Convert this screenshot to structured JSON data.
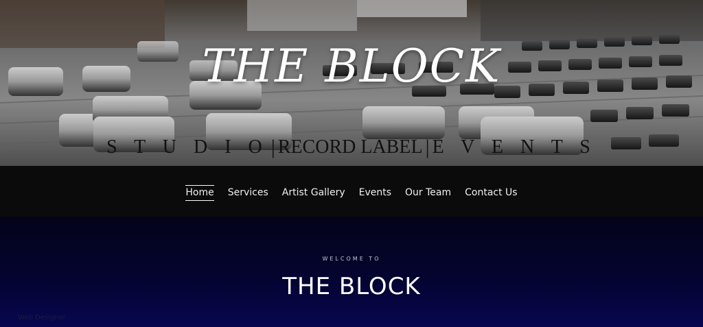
{
  "hero": {
    "title": "THE BLOCK",
    "tagline": {
      "part1": "S T U D I O",
      "part2": "RECORD LABEL",
      "part3": "E V E N T S",
      "separator": "|"
    }
  },
  "nav": {
    "items": [
      {
        "label": "Home",
        "active": true
      },
      {
        "label": "Services",
        "active": false
      },
      {
        "label": "Artist Gallery",
        "active": false
      },
      {
        "label": "Events",
        "active": false
      },
      {
        "label": "Our Team",
        "active": false
      },
      {
        "label": "Contact Us",
        "active": false
      }
    ]
  },
  "welcome": {
    "kicker": "WELCOME TO",
    "title": "THE BLOCK"
  },
  "footer": {
    "ghost_text": "Web Designer"
  },
  "colors": {
    "nav_background": "#0b0b0b",
    "welcome_top": "#03031a",
    "welcome_bottom": "#070650",
    "text_light": "#ffffff"
  }
}
